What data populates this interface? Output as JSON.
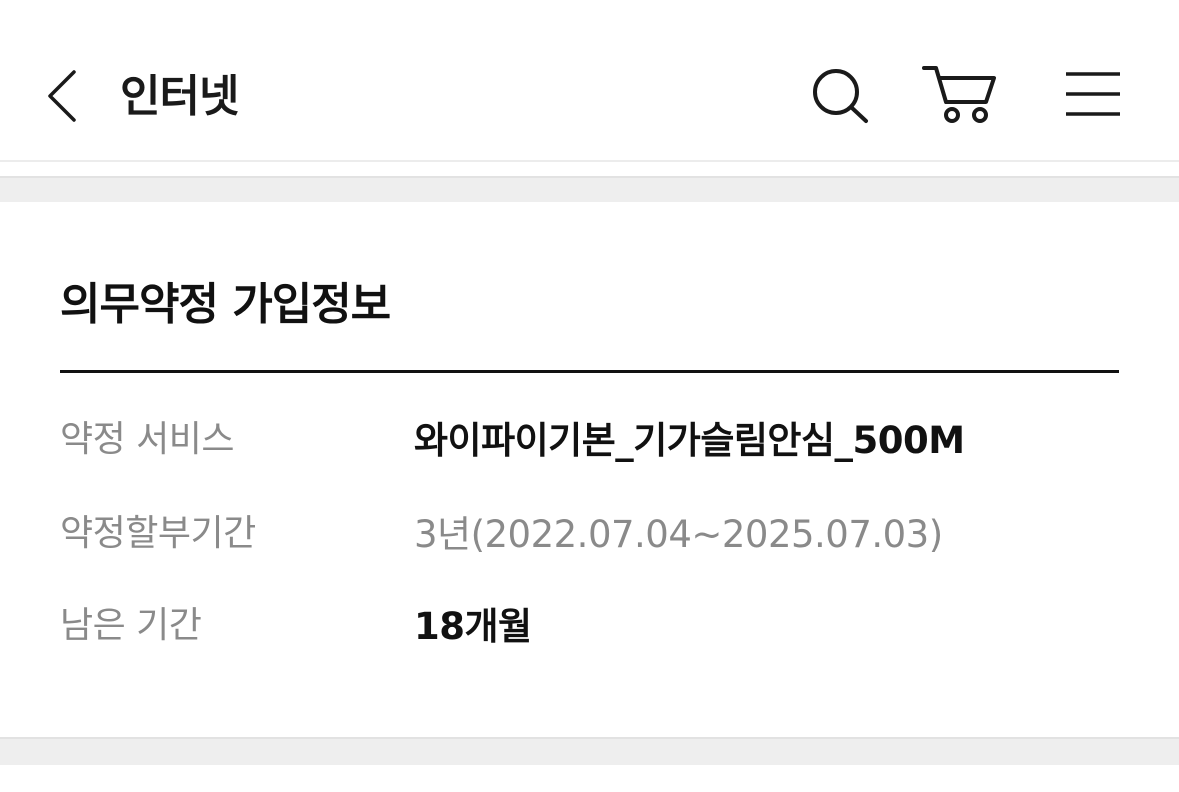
{
  "header": {
    "title": "인터넷",
    "back_icon": "chevron-left-icon",
    "search_icon": "search-icon",
    "cart_icon": "cart-icon",
    "menu_icon": "hamburger-menu-icon"
  },
  "section": {
    "title": "의무약정 가입정보",
    "rows": [
      {
        "label": "약정 서비스",
        "value": "와이파이기본_기가슬림안심_500M"
      },
      {
        "label": "약정할부기간",
        "value": "3년(2022.07.04~2025.07.03)"
      },
      {
        "label": "남은 기간",
        "value": "18개월"
      }
    ]
  },
  "colors": {
    "text_primary": "#111111",
    "text_muted": "#8a8a8a",
    "separator": "#eeeeee"
  }
}
